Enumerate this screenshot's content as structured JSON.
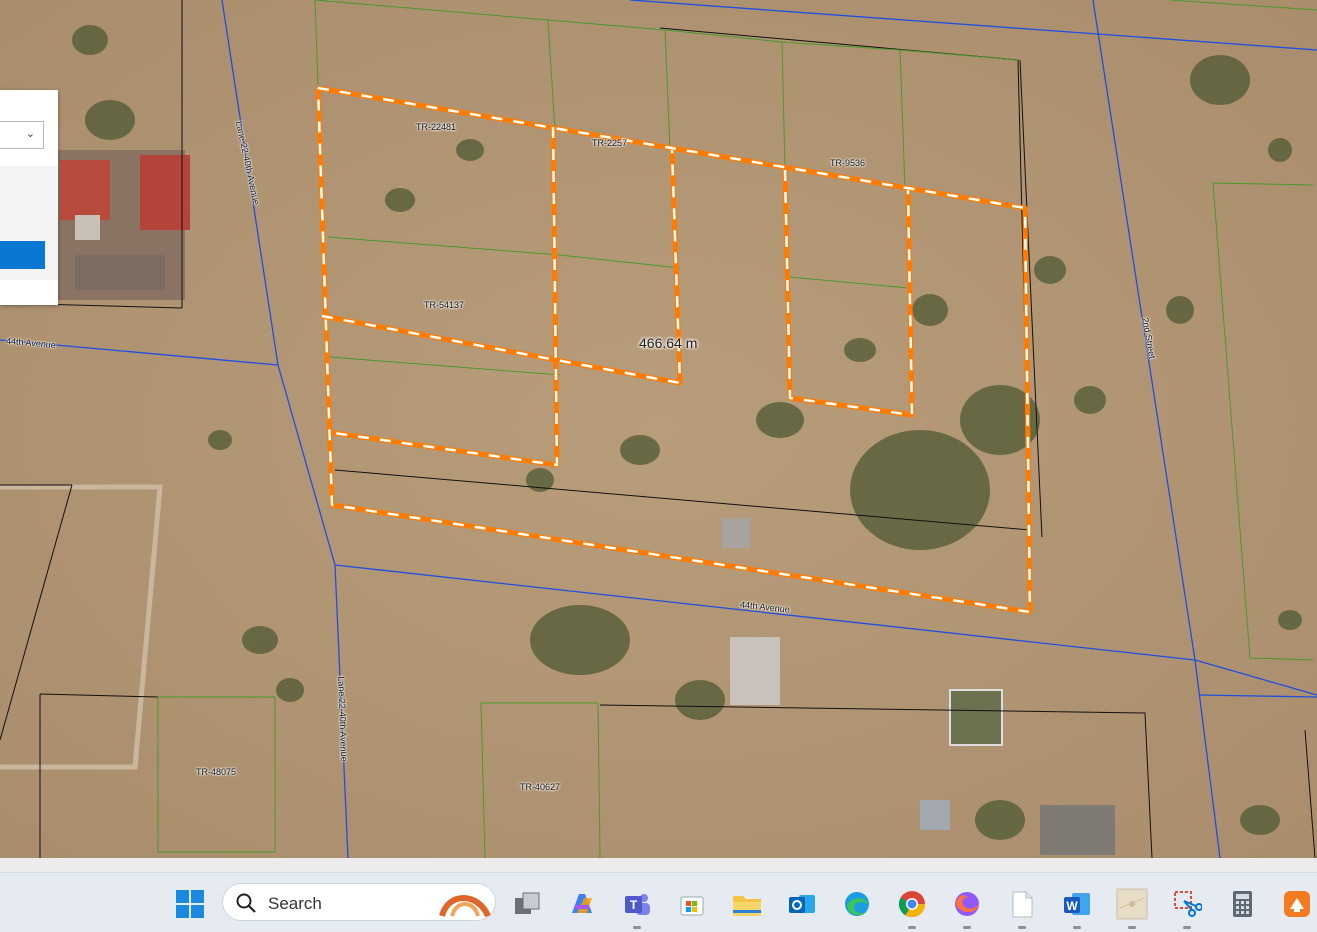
{
  "map": {
    "measurement": "466.64 m",
    "parcels": [
      "TR-22481",
      "TR-2257",
      "TR-9536",
      "TR-54137",
      "TR-48075",
      "TR-40627"
    ],
    "streets": {
      "avenue_west": "44th Avenue",
      "avenue_south": "44th Avenue",
      "lane_north": "Lane 22-40th Avenue",
      "lane_south": "Lane 22-40th Avenue",
      "street_east": "2nd Street"
    }
  },
  "taskbar": {
    "search_placeholder": "Search",
    "apps": [
      "Start",
      "Task View",
      "Copilot",
      "Teams",
      "Microsoft Store",
      "File Explorer",
      "Outlook",
      "Edge",
      "Chrome",
      "Firefox",
      "Notepad",
      "Word",
      "Maps",
      "Snipping Tool",
      "Calculator",
      "Presentation App"
    ]
  }
}
